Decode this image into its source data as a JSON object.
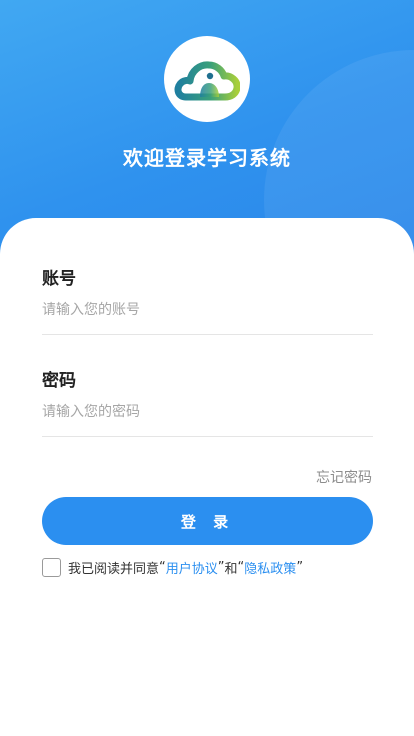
{
  "header": {
    "app_title": "欢迎登录学习系统",
    "logo_icon": "cloud-logo-icon"
  },
  "form": {
    "account_label": "账号",
    "account_placeholder": "请输入您的账号",
    "password_label": "密码",
    "password_placeholder": "请输入您的密码",
    "forgot_password": "忘记密码",
    "login_button": "登 录"
  },
  "agreement": {
    "prefix": "我已阅读并同意",
    "quote_open_1": "“",
    "user_agreement": "用户协议",
    "quote_close_1": "”",
    "and": "和",
    "quote_open_2": "“",
    "privacy_policy": "隐私政策",
    "quote_close_2": "”"
  },
  "colors": {
    "header_blue": "#2f92ee",
    "button_blue": "#2b8ff0",
    "link_blue": "#2b8ff0",
    "logo_teal": "#2a8c9c",
    "logo_green": "#9cc93a"
  }
}
